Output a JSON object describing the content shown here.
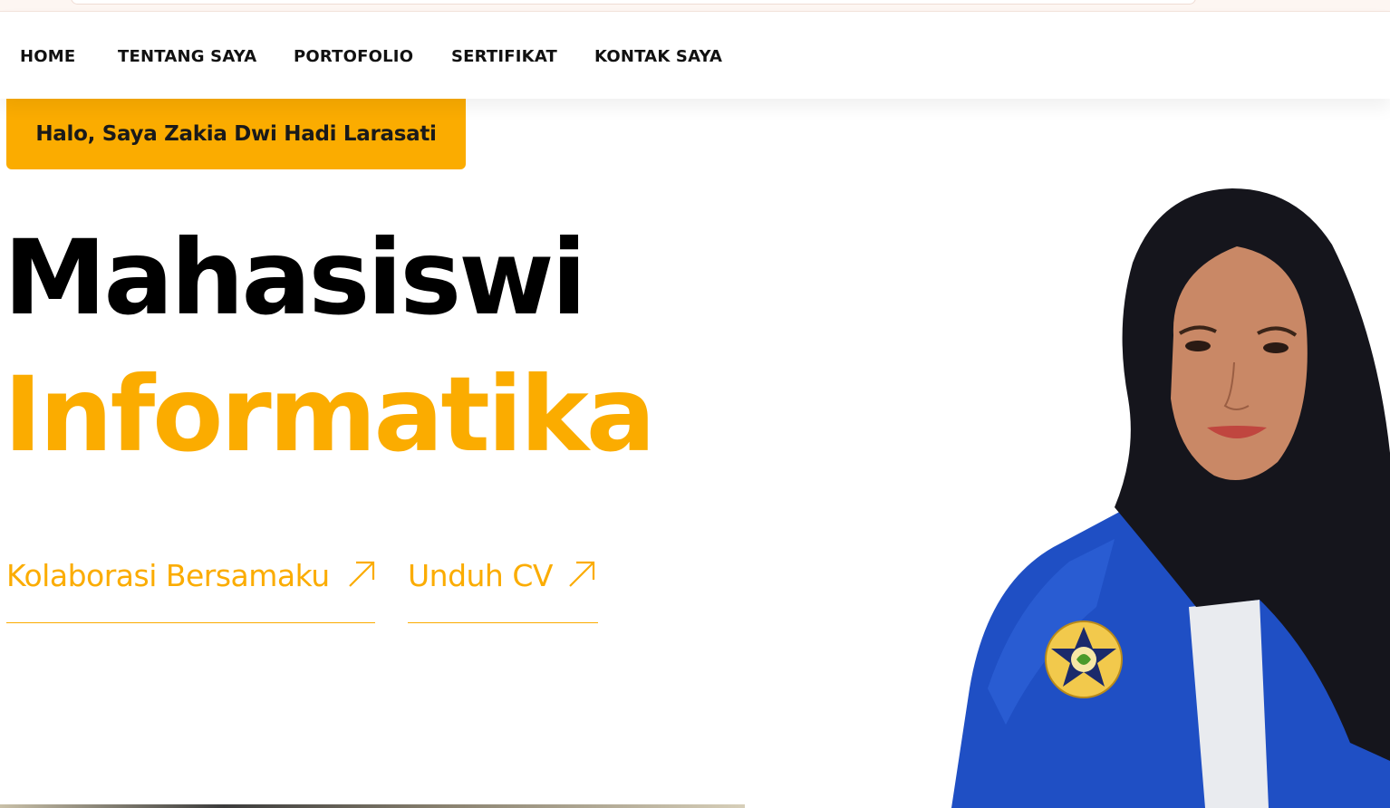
{
  "nav": {
    "items": [
      {
        "label": "HOME"
      },
      {
        "label": "TENTANG SAYA"
      },
      {
        "label": "PORTOFOLIO"
      },
      {
        "label": "SERTIFIKAT"
      },
      {
        "label": "KONTAK SAYA"
      }
    ]
  },
  "hero": {
    "greeting": "Halo, Saya Zakia Dwi Hadi Larasati",
    "title_line1": "Mahasiswi",
    "title_line2": "Informatika",
    "cta_collab": "Kolaborasi Bersamaku",
    "cta_cv": "Unduh CV",
    "cta_icon": "arrow-up-right-icon",
    "photo": "profile-photo"
  },
  "colors": {
    "accent": "#fbac00",
    "text": "#000000",
    "jacket": "#1f4fc4",
    "hijab": "#15151c"
  }
}
